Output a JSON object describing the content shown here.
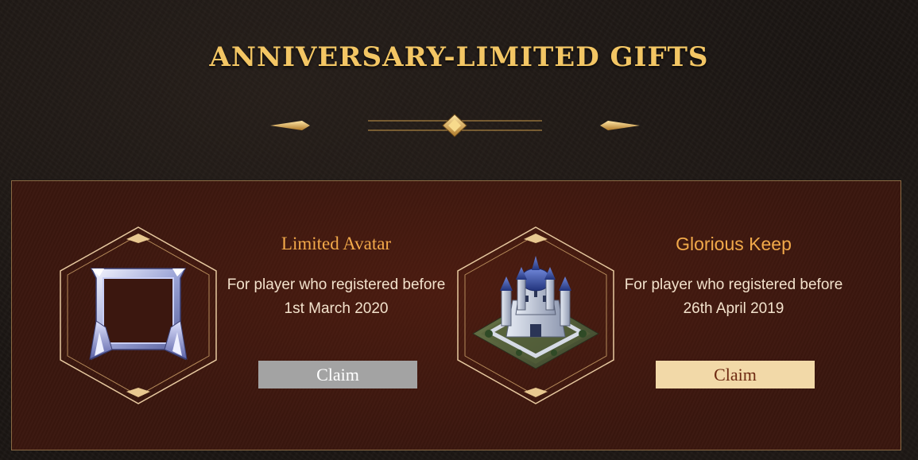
{
  "page": {
    "title": "ANNIVERSARY-LIMITED GIFTS"
  },
  "gifts": [
    {
      "name": "Limited Avatar",
      "condition_line1": "For player who registered before",
      "condition_line2": "1st March 2020",
      "claim_label": "Claim",
      "claim_state": "disabled",
      "icon": "avatar-frame-icon"
    },
    {
      "name": "Glorious Keep",
      "condition_line1": "For player who registered before",
      "condition_line2": "26th April 2019",
      "claim_label": "Claim",
      "claim_state": "active",
      "icon": "castle-keep-icon"
    }
  ],
  "colors": {
    "title_gold": "#f3c664",
    "gift_name": "#f2a94a",
    "panel_bg": "#3b170f",
    "claim_disabled": "#a3a3a3",
    "claim_active": "#f2d9a8",
    "claim_active_text": "#6e2a12"
  }
}
